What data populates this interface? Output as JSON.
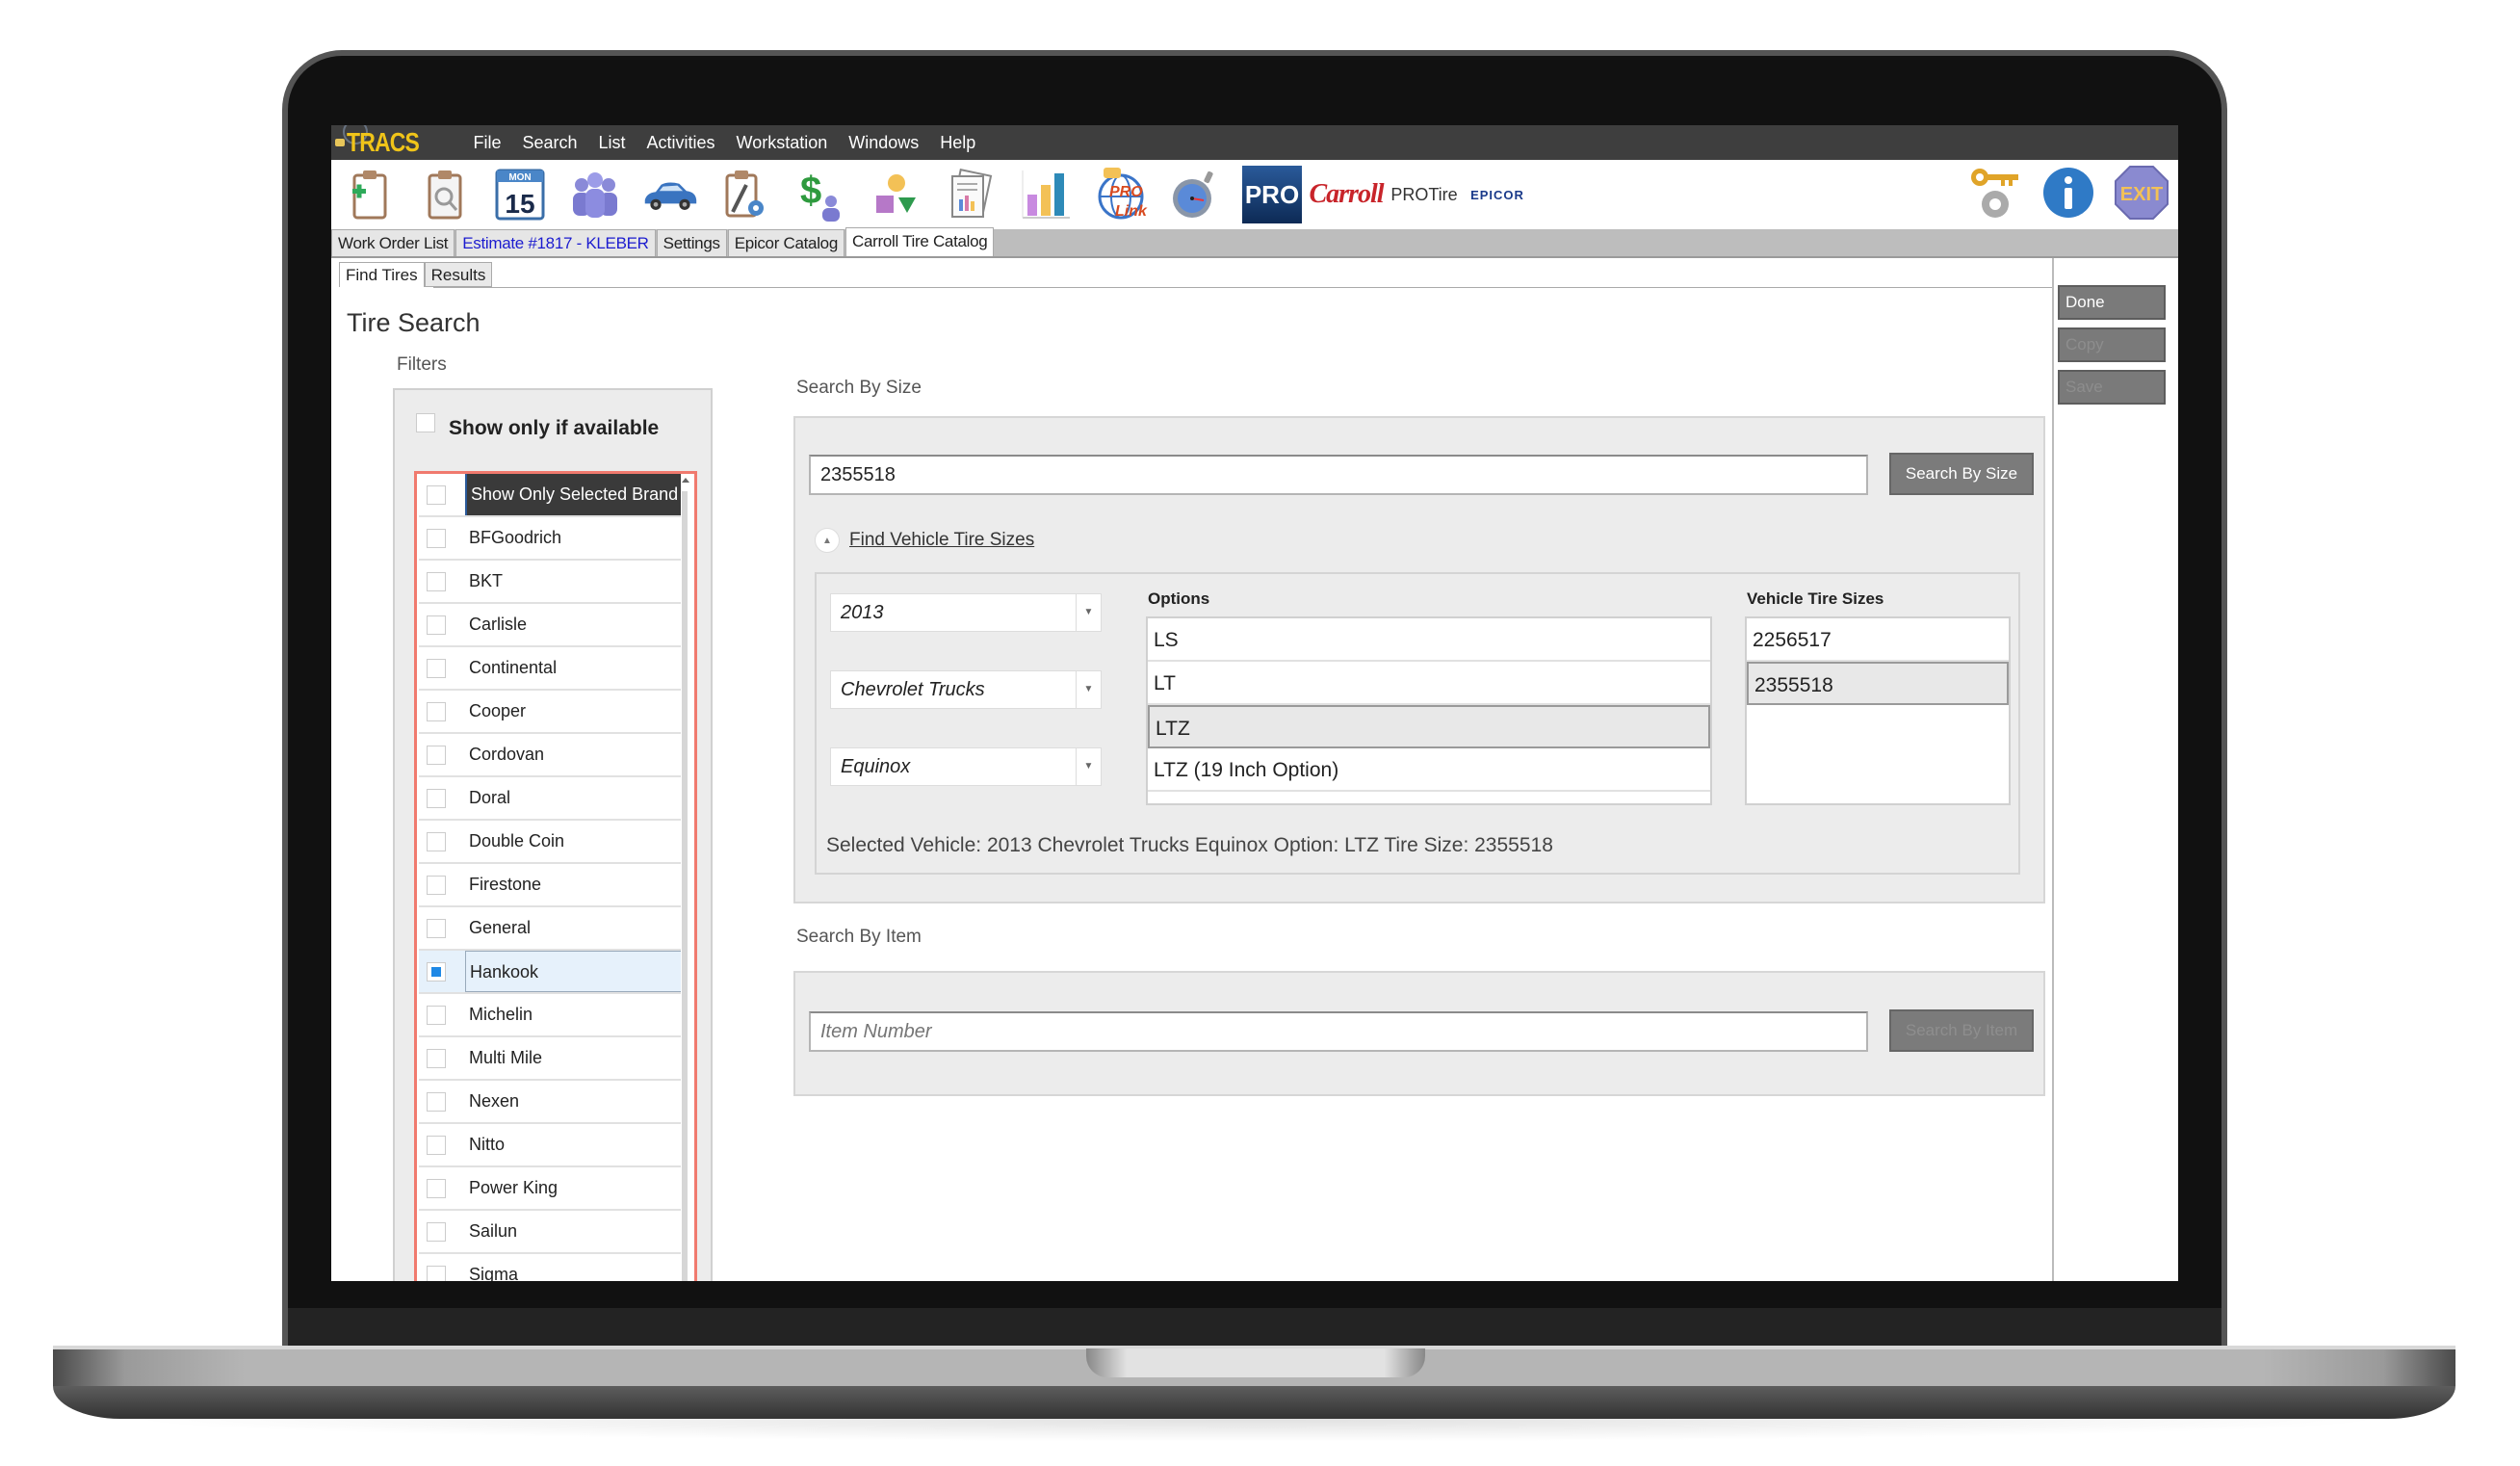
{
  "app": {
    "logo_text": "TRACS",
    "menu": [
      "File",
      "Search",
      "List",
      "Activities",
      "Workstation",
      "Windows",
      "Help"
    ]
  },
  "toolbar": {
    "icons": [
      {
        "name": "new-work-order-icon"
      },
      {
        "name": "find-work-order-icon"
      },
      {
        "name": "calendar-icon",
        "day": "MON",
        "date": "15"
      },
      {
        "name": "customers-icon"
      },
      {
        "name": "vehicle-icon"
      },
      {
        "name": "tech-tools-icon"
      },
      {
        "name": "accounting-icon"
      },
      {
        "name": "shapes-icon"
      },
      {
        "name": "reports-icon"
      },
      {
        "name": "chart-icon"
      },
      {
        "name": "prolink-icon",
        "text": "PRO Link"
      },
      {
        "name": "stopwatch-icon"
      }
    ],
    "brands": {
      "pro": "PRO",
      "carroll": "Carroll",
      "protire": "PROTire",
      "epicor": "EPICOR"
    },
    "right_icons": [
      "key-gear-icon",
      "info-icon",
      "exit-icon"
    ],
    "exit_text": "EXIT",
    "info_text": "i"
  },
  "tabs": [
    {
      "label": "Work Order List",
      "style": "normal"
    },
    {
      "label": "Estimate #1817 - KLEBER",
      "style": "blue"
    },
    {
      "label": "Settings",
      "style": "normal"
    },
    {
      "label": "Epicor Catalog",
      "style": "normal"
    },
    {
      "label": "Carroll Tire Catalog",
      "style": "active"
    }
  ],
  "subtabs": [
    {
      "label": "Find Tires",
      "active": true
    },
    {
      "label": "Results",
      "active": false
    }
  ],
  "page_title": "Tire Search",
  "filters": {
    "label": "Filters",
    "show_available_label": "Show only if available",
    "show_available_checked": false,
    "brand_header": "Show Only Selected Brand",
    "brands": [
      {
        "name": "BFGoodrich",
        "checked": false
      },
      {
        "name": "BKT",
        "checked": false
      },
      {
        "name": "Carlisle",
        "checked": false
      },
      {
        "name": "Continental",
        "checked": false
      },
      {
        "name": "Cooper",
        "checked": false
      },
      {
        "name": "Cordovan",
        "checked": false
      },
      {
        "name": "Doral",
        "checked": false
      },
      {
        "name": "Double Coin",
        "checked": false
      },
      {
        "name": "Firestone",
        "checked": false
      },
      {
        "name": "General",
        "checked": false
      },
      {
        "name": "Hankook",
        "checked": true
      },
      {
        "name": "Michelin",
        "checked": false
      },
      {
        "name": "Multi Mile",
        "checked": false
      },
      {
        "name": "Nexen",
        "checked": false
      },
      {
        "name": "Nitto",
        "checked": false
      },
      {
        "name": "Power King",
        "checked": false
      },
      {
        "name": "Sailun",
        "checked": false
      },
      {
        "name": "Sigma",
        "checked": false
      }
    ]
  },
  "search_by_size": {
    "label": "Search By Size",
    "value": "2355518",
    "button": "Search By Size",
    "expander_label": "Find Vehicle Tire Sizes",
    "year": "2013",
    "make": "Chevrolet Trucks",
    "model": "Equinox",
    "options_label": "Options",
    "options": [
      "LS",
      "LT",
      "LTZ",
      "LTZ (19 Inch Option)"
    ],
    "selected_option": "LTZ",
    "sizes_label": "Vehicle Tire Sizes",
    "sizes": [
      "2256517",
      "2355518"
    ],
    "selected_size": "2355518",
    "selected_info": "Selected Vehicle: 2013 Chevrolet Trucks Equinox  Option: LTZ  Tire Size: 2355518"
  },
  "search_by_item": {
    "label": "Search By Item",
    "placeholder": "Item Number",
    "button": "Search By Item"
  },
  "actions": {
    "done": "Done",
    "copy": "Copy",
    "save": "Save"
  }
}
